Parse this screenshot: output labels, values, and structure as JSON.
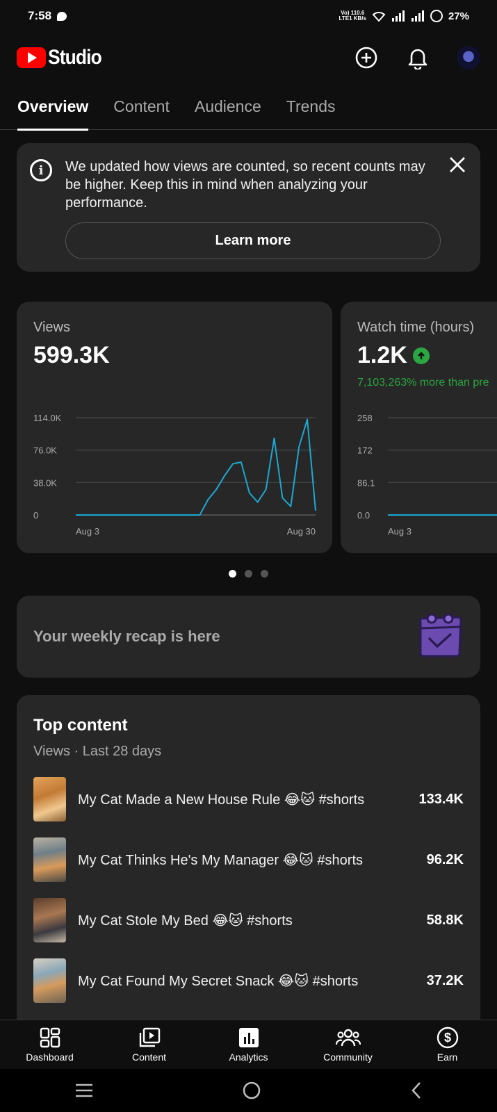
{
  "status_bar": {
    "time": "7:58",
    "net_top": "Vo) 110.6",
    "net_bottom": "LTE1 KB/s",
    "battery": "27%"
  },
  "header": {
    "app_name": "Studio"
  },
  "tabs": [
    {
      "label": "Overview",
      "active": true
    },
    {
      "label": "Content",
      "active": false
    },
    {
      "label": "Audience",
      "active": false
    },
    {
      "label": "Trends",
      "active": false
    }
  ],
  "banner": {
    "message": "We updated how views are counted, so recent counts may be higher. Keep this in mind when analyzing your performance.",
    "action_label": "Learn more"
  },
  "cards": {
    "views": {
      "label": "Views",
      "value": "599.3K"
    },
    "watch": {
      "label": "Watch time (hours)",
      "value": "1.2K",
      "delta": "7,103,263% more than pre"
    }
  },
  "chart_data": [
    {
      "type": "line",
      "title": "Views",
      "x_start": "Aug 3",
      "x_end": "Aug 30",
      "x_tick_labels": [
        "Aug 3",
        "Aug 30"
      ],
      "y_tick_labels": [
        "0",
        "38.0K",
        "76.0K",
        "114.0K"
      ],
      "ylim": [
        0,
        114000
      ],
      "grid": true,
      "series": [
        {
          "values": [
            0,
            0,
            0,
            0,
            0,
            0,
            0,
            0,
            0,
            0,
            0,
            0,
            0,
            0,
            0,
            0,
            18000,
            30000,
            46000,
            60000,
            62000,
            26000,
            15000,
            30000,
            90000,
            20000,
            10000,
            80000,
            112000,
            5000
          ]
        }
      ],
      "color": "#1da8d3"
    },
    {
      "type": "line",
      "title": "Watch time (hours)",
      "x_tick_labels": [
        "Aug 3"
      ],
      "y_tick_labels": [
        "0.0",
        "86.1",
        "172",
        "258"
      ],
      "ylim": [
        0,
        258
      ],
      "grid": true,
      "series": [
        {
          "values": [
            0,
            0,
            0,
            0,
            0,
            0,
            0,
            0
          ]
        }
      ],
      "color": "#1da8d3"
    }
  ],
  "carousel": {
    "pages": 3,
    "current": 1
  },
  "recap": {
    "label": "Your weekly recap is here"
  },
  "top_content": {
    "title": "Top content",
    "subtitle": "Views · Last 28 days",
    "items": [
      {
        "title": "My Cat Made a New House Rule 😂🐱 #shorts",
        "views": "133.4K"
      },
      {
        "title": "My Cat Thinks He's My Manager 😂🐱 #shorts",
        "views": "96.2K"
      },
      {
        "title": "My Cat Stole My Bed 😂🐱 #shorts",
        "views": "58.8K"
      },
      {
        "title": "My Cat Found My Secret Snack 😂🐱 #shorts",
        "views": "37.2K"
      }
    ]
  },
  "bottom_nav": [
    {
      "label": "Dashboard",
      "icon": "dashboard-icon"
    },
    {
      "label": "Content",
      "icon": "content-icon"
    },
    {
      "label": "Analytics",
      "icon": "analytics-icon"
    },
    {
      "label": "Community",
      "icon": "community-icon"
    },
    {
      "label": "Earn",
      "icon": "earn-icon"
    }
  ]
}
